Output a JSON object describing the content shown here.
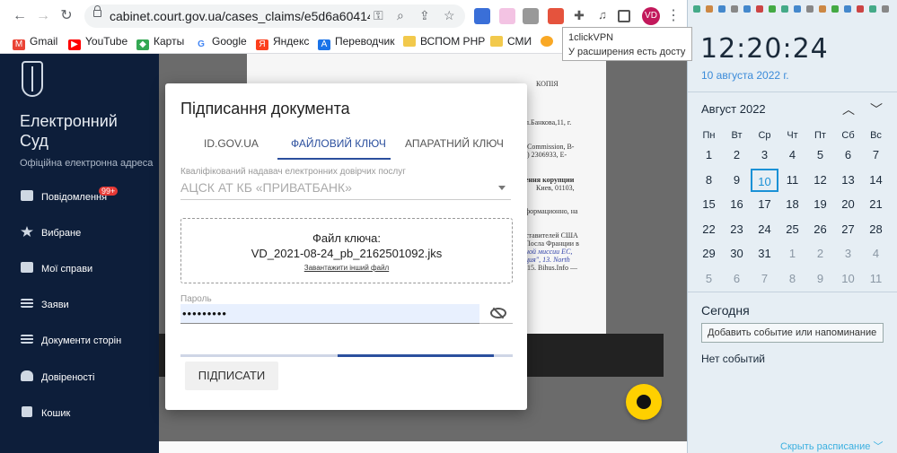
{
  "browser": {
    "url": "cabinet.court.gov.ua/cases_claims/e5d6a60414187ea...",
    "profile_initials": "VD",
    "bookmarks": [
      "Gmail",
      "YouTube",
      "Карты",
      "Google",
      "Яндекс",
      "Переводчик",
      "ВСПОМ РНР",
      "СМИ"
    ],
    "tooltip": {
      "title": "1clickVPN",
      "text": "У расширения есть доступ"
    }
  },
  "sidebar": {
    "brand": "Електронний Суд",
    "subtitle": "Офіційна електронна адреса",
    "items": [
      {
        "label": "Повідомлення",
        "badge": "99+",
        "icon": "chat-icon"
      },
      {
        "label": "Вибране",
        "icon": "star-icon"
      },
      {
        "label": "Мої справи",
        "icon": "folder-icon"
      },
      {
        "label": "Заяви",
        "icon": "list-icon"
      },
      {
        "label": "Документи сторін",
        "icon": "list-icon"
      },
      {
        "label": "Довіреності",
        "icon": "people-icon"
      },
      {
        "label": "Кошик",
        "icon": "trash-icon"
      }
    ]
  },
  "document": {
    "header": "КОПІЯ",
    "lines": [
      "л.Банкова,11, г.",
      "Commission, B-",
      ") 2306933, E-",
      "ення корупции",
      "Киев, 01103,",
      "формационно, на",
      "ставителей США",
      "Посла Франции в",
      "ной миссии ЕС,",
      "ция\", 13. North",
      "15. Bihus.Info —"
    ]
  },
  "modal": {
    "title": "Підписання документа",
    "tabs": [
      "ID.GOV.UA",
      "ФАЙЛОВИЙ КЛЮЧ",
      "АПАРАТНИЙ КЛЮЧ"
    ],
    "active_tab": 1,
    "provider_label": "Кваліфікований надавач електронних довірчих послуг",
    "provider_value": "АЦСК АТ КБ «ПРИВАТБАНК»",
    "key_file_label": "Файл ключа:",
    "key_file_name": "VD_2021-08-24_pb_2162501092.jks",
    "upload_other": "Завантажити інший файл",
    "password_label": "Пароль",
    "password_value": "•••••••••",
    "progress": 0.53,
    "sign_button": "ПІДПИСАТИ"
  },
  "clock": {
    "time": "12:20:24",
    "date": "10 августа 2022 г.",
    "month": "Август 2022",
    "weekdays": [
      "Пн",
      "Вт",
      "Ср",
      "Чт",
      "Пт",
      "Сб",
      "Вс"
    ],
    "days": [
      [
        "1",
        "2",
        "3",
        "4",
        "5",
        "6",
        "7"
      ],
      [
        "8",
        "9",
        "10",
        "11",
        "12",
        "13",
        "14"
      ],
      [
        "15",
        "16",
        "17",
        "18",
        "19",
        "20",
        "21"
      ],
      [
        "22",
        "23",
        "24",
        "25",
        "26",
        "27",
        "28"
      ],
      [
        "29",
        "30",
        "31",
        "1",
        "2",
        "3",
        "4"
      ],
      [
        "5",
        "6",
        "7",
        "8",
        "9",
        "10",
        "11"
      ]
    ],
    "today_label": "Сегодня",
    "add_event": "Добавить событие или напоминание",
    "no_events": "Нет событий",
    "hide_schedule": "Скрыть расписание ﹀"
  }
}
